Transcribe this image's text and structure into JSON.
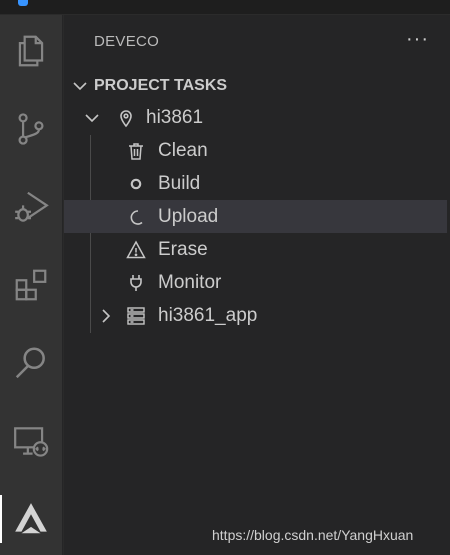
{
  "sidebar": {
    "title": "DEVECO",
    "more_actions": "···",
    "section": {
      "title": "PROJECT TASKS"
    },
    "tree": {
      "project": {
        "label": "hi3861",
        "icon": "map-pin-icon",
        "expanded": true
      },
      "tasks": [
        {
          "label": "Clean",
          "icon": "trash-icon"
        },
        {
          "label": "Build",
          "icon": "circle-icon"
        },
        {
          "label": "Upload",
          "icon": "moon-icon",
          "selected": true
        },
        {
          "label": "Erase",
          "icon": "warning-icon"
        },
        {
          "label": "Monitor",
          "icon": "plug-icon"
        }
      ],
      "app": {
        "label": "hi3861_app",
        "icon": "server-icon",
        "expanded": false
      }
    }
  },
  "activity_bar": {
    "items": [
      {
        "name": "explorer",
        "icon": "files-icon"
      },
      {
        "name": "source-control",
        "icon": "source-control-icon"
      },
      {
        "name": "run-debug",
        "icon": "run-debug-icon"
      },
      {
        "name": "extensions",
        "icon": "extensions-icon"
      },
      {
        "name": "search",
        "icon": "search-icon"
      },
      {
        "name": "remote-explorer",
        "icon": "remote-explorer-icon"
      },
      {
        "name": "deveco",
        "icon": "deveco-icon",
        "active": true
      }
    ]
  },
  "watermark": "https://blog.csdn.net/YangHxuan",
  "colors": {
    "sidebar_bg": "#252526",
    "activity_bg": "#333333",
    "selected_row": "#37373d",
    "text": "#cccccc",
    "icon": "#c5c5c5",
    "icon_inactive": "#858585"
  }
}
